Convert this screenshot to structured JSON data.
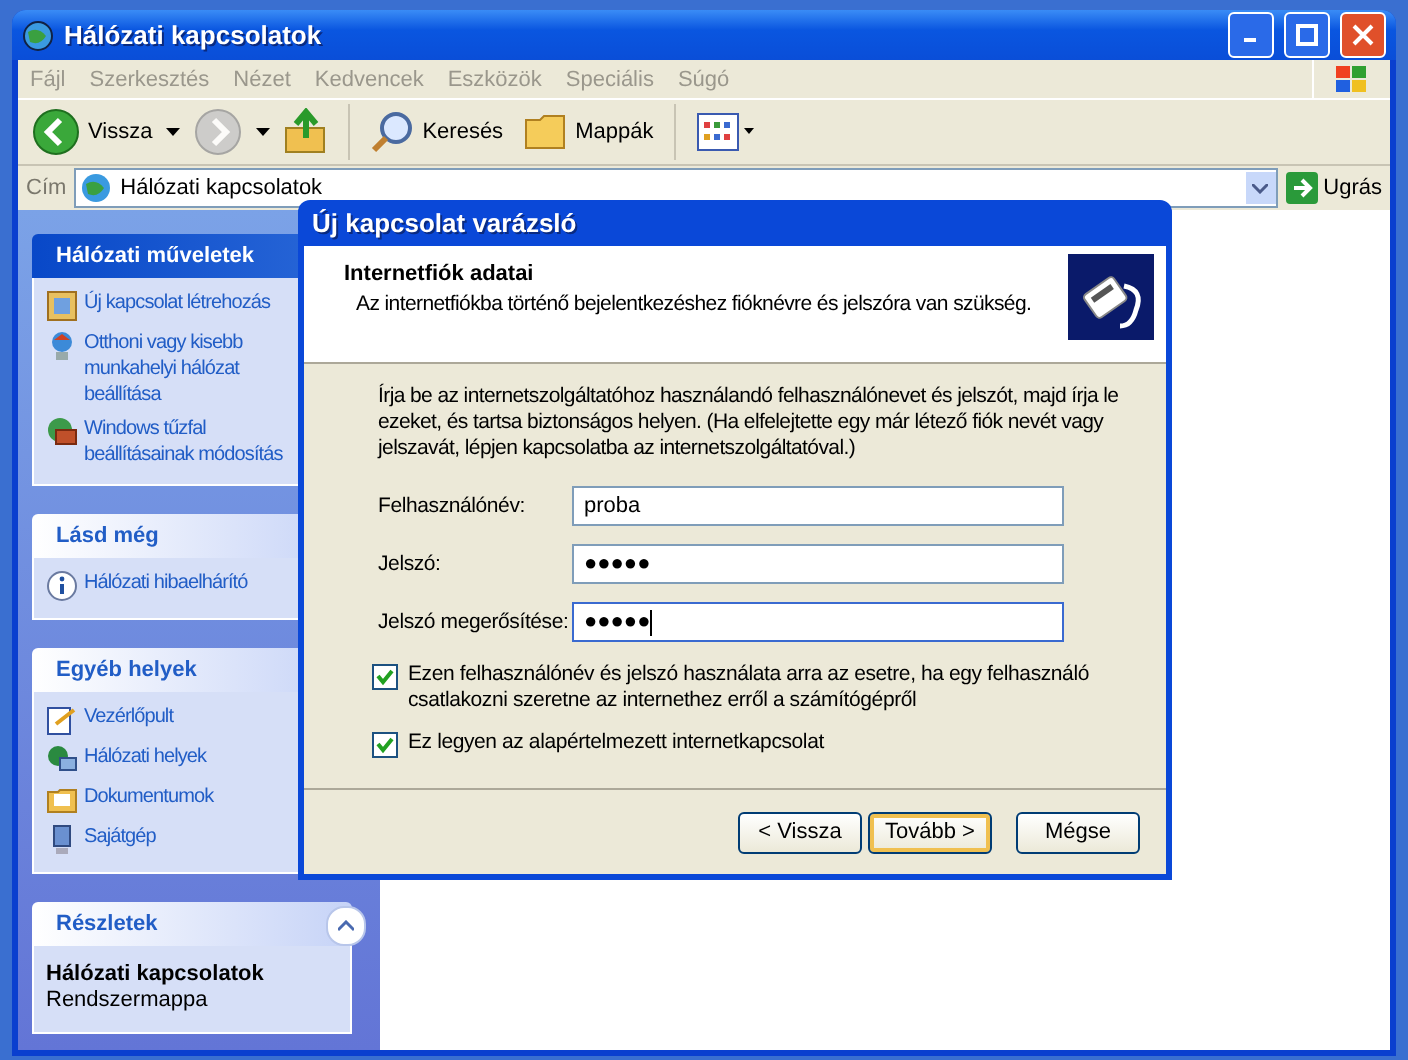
{
  "window": {
    "title": "Hálózati kapcsolatok"
  },
  "menu": [
    {
      "label": "Fájl"
    },
    {
      "label": "Szerkesztés"
    },
    {
      "label": "Nézet"
    },
    {
      "label": "Kedvencek"
    },
    {
      "label": "Eszközök"
    },
    {
      "label": "Speciális"
    },
    {
      "label": "Súgó"
    }
  ],
  "toolbar": [
    {
      "kind": "back",
      "label": "Vissza",
      "disabled": false
    },
    {
      "kind": "forward",
      "disabled": true
    },
    {
      "kind": "up",
      "disabled": false
    },
    {
      "kind": "search",
      "label": "Keresés",
      "disabled": false
    },
    {
      "kind": "folders",
      "label": "Mappák",
      "disabled": false
    },
    {
      "kind": "views",
      "disabled": false
    }
  ],
  "address": {
    "label": "Cím",
    "value": "Hálózati kapcsolatok",
    "go": "Ugrás"
  },
  "sidebar": {
    "panels": [
      {
        "title": "Hálózati műveletek",
        "items": [
          {
            "label": "Új kapcsolat létrehozás"
          },
          {
            "label": "Otthoni vagy kisebb munkahelyi hálózat beállítása"
          },
          {
            "label": "Windows tűzfal beállításainak módosítás"
          }
        ]
      },
      {
        "title": "Lásd még",
        "items": [
          {
            "label": "Hálózati hibaelhárító"
          }
        ]
      },
      {
        "title": "Egyéb helyek",
        "items": [
          {
            "label": "Vezérlőpult"
          },
          {
            "label": "Hálózati helyek"
          },
          {
            "label": "Dokumentumok"
          },
          {
            "label": "Sajátgép"
          }
        ]
      }
    ],
    "details": {
      "title": "Részletek",
      "expanded": true,
      "name": "Hálózati kapcsolatok",
      "type": "Rendszermappa"
    }
  },
  "dialog": {
    "title": "Új kapcsolat varázsló",
    "heading": "Internetfiók adatai",
    "subheading": "Az internetfiókba történő bejelentkezéshez fióknévre és jelszóra van szükség.",
    "intro": "Írja be az internetszolgáltatóhoz használandó felhasználónevet és jelszót, majd írja le ezeket, és tartsa biztonságos helyen. (Ha elfelejtette egy már létező fiók nevét vagy jelszavát, lépjen kapcsolatba az internetszolgáltatóval.)",
    "fields": [
      {
        "label": "Felhasználónév:",
        "value": "proba",
        "focused": false
      },
      {
        "label": "Jelszó:",
        "value": "●●●●●",
        "focused": false
      },
      {
        "label": "Jelszó megerősítése:",
        "value": "●●●●●",
        "focused": true
      }
    ],
    "checkboxes": [
      {
        "label": "Ezen felhasználónév és jelszó használata arra az esetre, ha egy felhasználó csatlakozni szeretne az internethez erről a számítógépről",
        "checked": true
      },
      {
        "label": "Ez legyen az alapértelmezett internetkapcsolat",
        "checked": true
      }
    ],
    "buttons": [
      {
        "label": "< Vissza",
        "default": false
      },
      {
        "label": "Tovább >",
        "default": true
      },
      {
        "label": "Mégse",
        "default": false
      }
    ]
  }
}
